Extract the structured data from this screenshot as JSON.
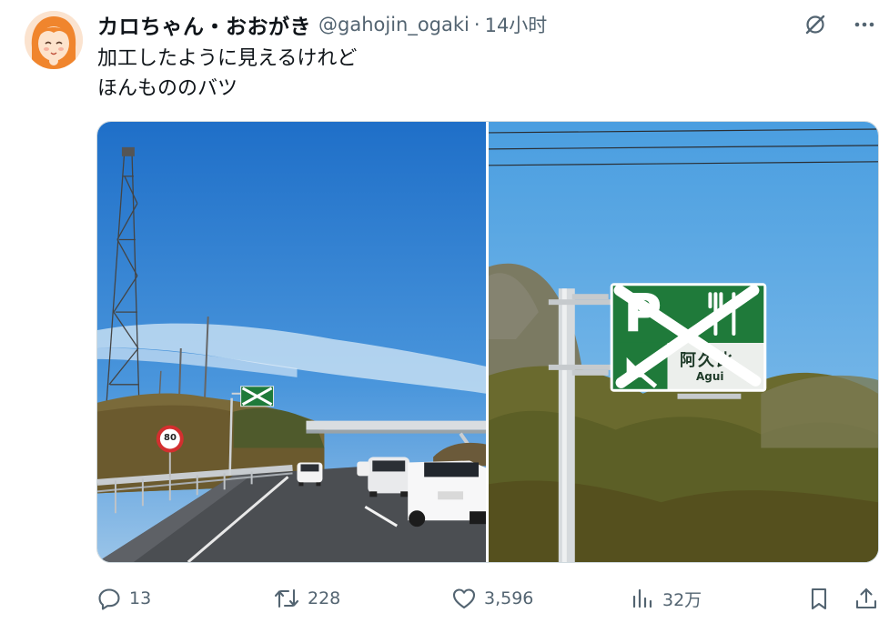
{
  "author": {
    "display_name": "カロちゃん・おおがき",
    "handle": "@gahojin_ogaki",
    "separator": "·",
    "time": "14小时"
  },
  "tweet": {
    "lines": [
      "加工したように見えるけれど",
      "ほんもののバツ"
    ]
  },
  "media": {
    "left": {
      "speed_sign": "80",
      "sign_color": "#1f7a3a"
    },
    "right": {
      "sign_jp": "阿久比",
      "sign_en": "Agui",
      "sign_letter": "P",
      "sign_color": "#1f7a3a"
    }
  },
  "actions": {
    "replies": "13",
    "retweets": "228",
    "likes": "3,596",
    "views": "32万"
  },
  "icons": {
    "top": [
      "grok-slash-icon",
      "more-icon"
    ],
    "bottom": [
      "reply-icon",
      "retweet-icon",
      "like-icon",
      "views-icon",
      "bookmark-icon",
      "share-icon"
    ]
  },
  "colors": {
    "text": "#0f1419",
    "secondary": "#536471",
    "border": "#cfd9de"
  }
}
